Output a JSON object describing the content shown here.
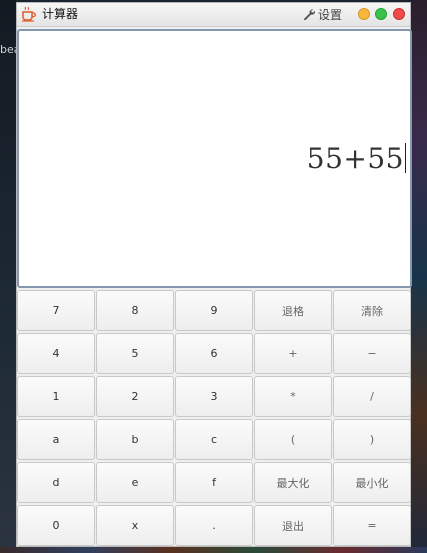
{
  "desktop": {
    "left_snippet": "bea"
  },
  "window": {
    "title": "计算器",
    "settings_label": "设置",
    "buttons": {
      "minimize_color": "#f6b73c",
      "maximize_color": "#38c24a",
      "close_color": "#f04a4a"
    }
  },
  "display": {
    "expression": "55+55"
  },
  "keypad": {
    "rows": [
      [
        "7",
        "8",
        "9",
        "退格",
        "清除"
      ],
      [
        "4",
        "5",
        "6",
        "+",
        "−"
      ],
      [
        "1",
        "2",
        "3",
        "*",
        "/"
      ],
      [
        "a",
        "b",
        "c",
        "(",
        ")"
      ],
      [
        "d",
        "e",
        "f",
        "最大化",
        "最小化"
      ],
      [
        "0",
        "x",
        ".",
        "退出",
        "="
      ]
    ]
  }
}
